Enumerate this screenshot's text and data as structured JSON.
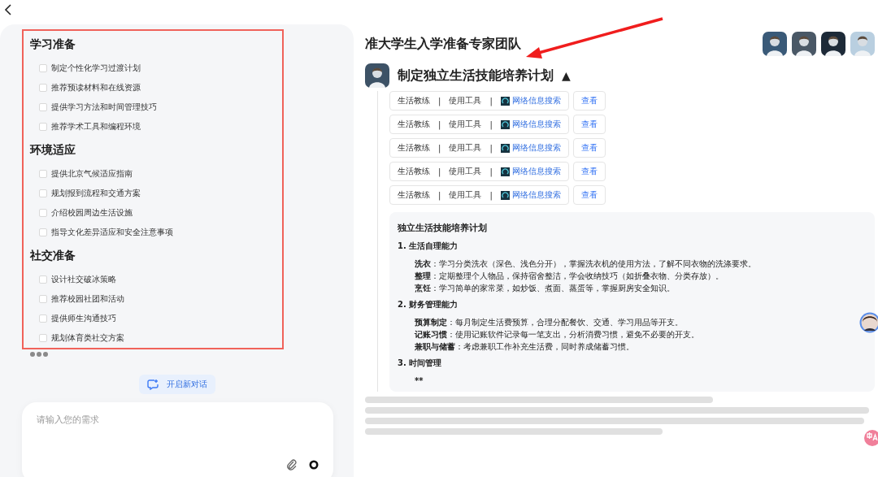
{
  "left_panel": {
    "sections": [
      {
        "heading": "学习准备",
        "items": [
          {
            "label": "制定个性化学习过渡计划",
            "checked": false
          },
          {
            "label": "推荐预读材料和在线资源",
            "checked": false
          },
          {
            "label": "提供学习方法和时间管理技巧",
            "checked": false
          },
          {
            "label": "推荐学术工具和编程环境",
            "checked": false
          }
        ]
      },
      {
        "heading": "环境适应",
        "items": [
          {
            "label": "提供北京气候适应指南",
            "checked": false
          },
          {
            "label": "规划报到流程和交通方案",
            "checked": false
          },
          {
            "label": "介绍校园周边生活设施",
            "checked": false
          },
          {
            "label": "指导文化差异适应和安全注意事项",
            "checked": false
          }
        ]
      },
      {
        "heading": "社交准备",
        "items": [
          {
            "label": "设计社交破冰策略",
            "checked": false
          },
          {
            "label": "推荐校园社团和活动",
            "checked": false
          },
          {
            "label": "提供师生沟通技巧",
            "checked": false
          },
          {
            "label": "规划体育类社交方案",
            "checked": false
          }
        ]
      }
    ],
    "new_chat_button": "开启新对话",
    "input": {
      "placeholder": "请输入您的需求"
    }
  },
  "team": {
    "title": "准大学生入学准备专家团队"
  },
  "task": {
    "title": "制定独立生活技能培养计划",
    "toggle": "▲",
    "expanded": true,
    "tool_calls": [
      {
        "role": "生活教练",
        "separator_1": "|",
        "action": "使用工具",
        "separator_2": "|",
        "tool": "网络信息搜索",
        "button": "查看"
      },
      {
        "role": "生活教练",
        "separator_1": "|",
        "action": "使用工具",
        "separator_2": "|",
        "tool": "网络信息搜索",
        "button": "查看"
      },
      {
        "role": "生活教练",
        "separator_1": "|",
        "action": "使用工具",
        "separator_2": "|",
        "tool": "网络信息搜索",
        "button": "查看"
      },
      {
        "role": "生活教练",
        "separator_1": "|",
        "action": "使用工具",
        "separator_2": "|",
        "tool": "网络信息搜索",
        "button": "查看"
      },
      {
        "role": "生活教练",
        "separator_1": "|",
        "action": "使用工具",
        "separator_2": "|",
        "tool": "网络信息搜索",
        "button": "查看"
      }
    ],
    "document": {
      "title": "独立生活技能培养计划",
      "sections": [
        {
          "heading": "1. 生活自理能力",
          "lines": [
            "**洗衣**：学习分类洗衣（深色、浅色分开），掌握洗衣机的使用方法，了解不同衣物的洗涤要求。",
            "**整理**：定期整理个人物品，保持宿舍整洁，学会收纳技巧（如折叠衣物、分类存放）。",
            "**烹饪**：学习简单的家常菜，如炒饭、煮面、蒸蛋等，掌握厨房安全知识。"
          ]
        },
        {
          "heading": "2. 财务管理能力",
          "lines": [
            "**预算制定**：每月制定生活费预算，合理分配餐饮、交通、学习用品等开支。",
            "**记账习惯**：使用记账软件记录每一笔支出，分析消费习惯，避免不必要的开支。",
            "**兼职与储蓄**：考虑兼职工作补充生活费，同时养成储蓄习惯。"
          ]
        },
        {
          "heading": "3. 时间管理",
          "plain": [
            "**"
          ]
        }
      ]
    }
  }
}
